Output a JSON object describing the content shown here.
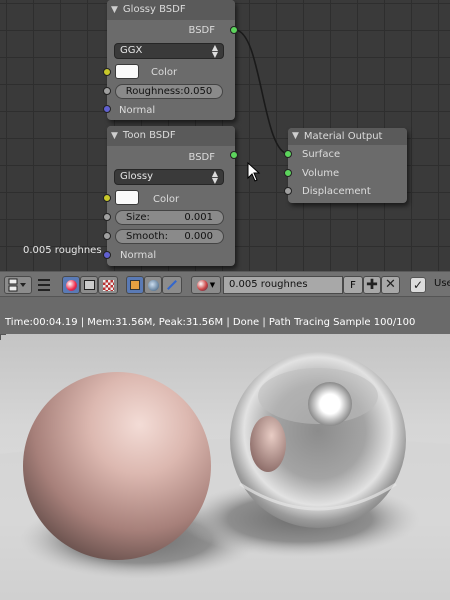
{
  "node_editor": {
    "glossy_node": {
      "title": "Glossy BSDF",
      "output_label": "BSDF",
      "distribution": "GGX",
      "color_label": "Color",
      "roughness_label": "Roughness:",
      "roughness_value": "0.050",
      "normal_label": "Normal"
    },
    "toon_node": {
      "title": "Toon BSDF",
      "output_label": "BSDF",
      "component": "Glossy",
      "color_label": "Color",
      "size_label": "Size:",
      "size_value": "0.001",
      "smooth_label": "Smooth:",
      "smooth_value": "0.000",
      "normal_label": "Normal"
    },
    "output_node": {
      "title": "Material Output",
      "inputs": [
        "Surface",
        "Volume",
        "Displacement"
      ]
    },
    "frame_label": "0.005 roughnes",
    "colors": {
      "socket_shader": "#5cd45c",
      "socket_color": "#c8c82a",
      "socket_value": "#a0a0a0",
      "socket_vector": "#6060d0"
    }
  },
  "header_bar": {
    "material_name": "0.005 roughnes",
    "fake_user_button": "F",
    "use_nodes_label": "Use"
  },
  "status_bar": {
    "text": "Time:00:04.19 | Mem:31.56M, Peak:31.56M | Done | Path Tracing Sample 100/100"
  }
}
